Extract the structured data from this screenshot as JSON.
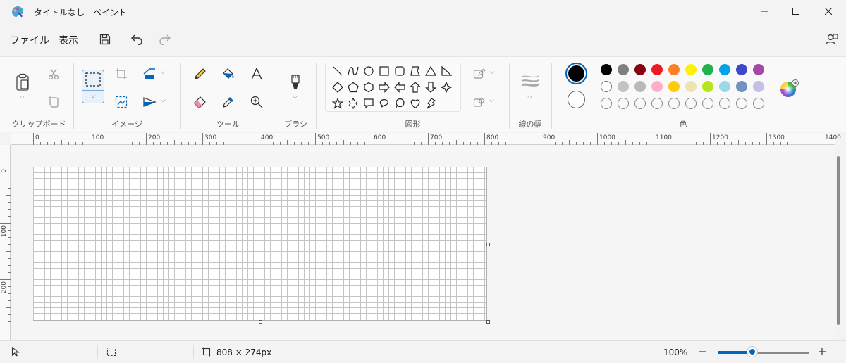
{
  "window": {
    "title": "タイトルなし - ペイント",
    "minimize_icon": "minimize-icon",
    "maximize_icon": "maximize-icon",
    "close_icon": "close-icon"
  },
  "menu": {
    "file": "ファイル",
    "view": "表示"
  },
  "ribbon": {
    "clipboard": {
      "label": "クリップボード"
    },
    "image": {
      "label": "イメージ"
    },
    "tools": {
      "label": "ツール"
    },
    "brush": {
      "label": "ブラシ"
    },
    "shapes": {
      "label": "図形"
    },
    "size": {
      "label": "線の幅"
    },
    "colors": {
      "label": "色",
      "color1": "#000000",
      "color2": "#ffffff",
      "row1": [
        "#000000",
        "#7f7f7f",
        "#880015",
        "#ed1c24",
        "#ff7f27",
        "#fff200",
        "#22b14c",
        "#00a2e8",
        "#3f48cc",
        "#a349a4"
      ],
      "row2": [
        "#ffffff",
        "#c3c3c3",
        "#b9b9b9",
        "#ffaec9",
        "#ffc90e",
        "#efe4b0",
        "#b5e61d",
        "#99d9ea",
        "#7092be",
        "#c8bfe7"
      ],
      "row3": [
        "",
        "",
        "",
        "",
        "",
        "",
        "",
        "",
        "",
        ""
      ]
    }
  },
  "ruler": {
    "h_labels": [
      "0",
      "100",
      "200",
      "300",
      "400",
      "500",
      "600",
      "700",
      "800",
      "900",
      "1000",
      "1100",
      "1200",
      "1300",
      "1400"
    ],
    "v_labels": [
      "0",
      "100",
      "200"
    ]
  },
  "status": {
    "canvas_size": "808 × 274px",
    "zoom": "100%",
    "zoom_fraction": 0.38
  }
}
